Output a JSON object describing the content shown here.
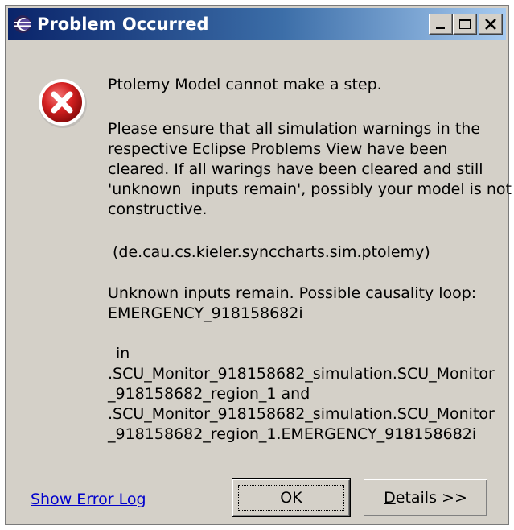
{
  "window": {
    "title": "Problem Occurred",
    "icon": "eclipse-icon"
  },
  "titlebar_buttons": {
    "minimize": "minimize-icon",
    "maximize": "maximize-icon",
    "close": "close-icon"
  },
  "message": {
    "icon": "error-icon",
    "title": "Ptolemy Model cannot make a step.",
    "body_lines": [
      "Please ensure that all simulation warnings in the",
      "respective Eclipse Problems View have been",
      "cleared. If all warings have been cleared and still",
      "'unknown  inputs remain', possibly your model is not",
      "constructive."
    ],
    "plugin": "(de.cau.cs.kieler.synccharts.sim.ptolemy)",
    "detail_lines": [
      "Unknown inputs remain. Possible causality loop:",
      "EMERGENCY_918158682i"
    ],
    "in_label": "in",
    "path_lines": [
      ".SCU_Monitor_918158682_simulation.SCU_Monitor",
      "_918158682_region_1 and",
      ".SCU_Monitor_918158682_simulation.SCU_Monitor",
      "_918158682_region_1.EMERGENCY_918158682i"
    ]
  },
  "footer": {
    "link": "Show Error Log",
    "ok_label": "OK",
    "details_mnemonic": "D",
    "details_rest": "etails >>"
  },
  "colors": {
    "error_red": "#d42020",
    "dialog_bg": "#d4d0c8",
    "title_start": "#0a246a",
    "link": "#0000cc"
  }
}
